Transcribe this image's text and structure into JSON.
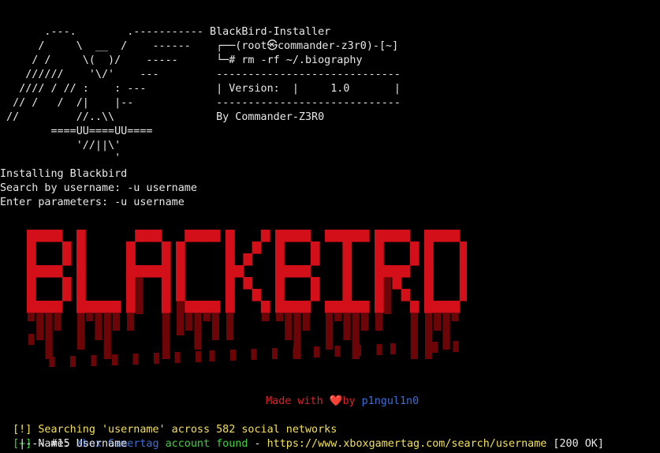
{
  "terminal": {
    "ascii_art": [
      "       .---.        .----------- BlackBird-Installer",
      "      /     \\  __  /    ------    ┌──(root㉿commander-z3r0)-[~]",
      "     / /     \\(  )/    -----      └─# rm -rf ~/.biography",
      "    //////    '\\/'    ---         -----------------------------",
      "   //// / // :    : ---           | Version:  |     1.0       |",
      "  // /   /  /|    |--             -----------------------------",
      " //         //..\\\\                By Commander-Z3R0",
      "        ====UU====UU====",
      "            '//||\\'",
      "                  '"
    ],
    "install_lines": [
      "Installing Blackbird",
      "Search by username: -u username",
      "Enter parameters: -u username"
    ],
    "logo_text": "BLACKBIRD",
    "made_with": {
      "prefix": "Made with ",
      "heart": "❤️",
      "by": "by ",
      "author": "p1ngul1n0"
    },
    "search_line": {
      "marker": "[!]",
      "text": " Searching 'username' across 582 social networks"
    },
    "result_line": {
      "marker": "[+]",
      "dash": " - ",
      "index": "#15 ",
      "site": "Xbox Gamertag",
      "found": " account found",
      "sep": " - ",
      "url": "https://www.xboxgamertag.com/search/username",
      "status": " [200 OK]"
    },
    "name_line": "   |--Name: Username"
  },
  "colors": {
    "background": "#000000",
    "text": "#e8e8e8",
    "yellow": "#f1e05a",
    "green": "#3fd13f",
    "blue": "#3d6fd8",
    "red": "#e0212a",
    "logo_red": "#d3101a",
    "logo_dark": "#6b0508"
  }
}
